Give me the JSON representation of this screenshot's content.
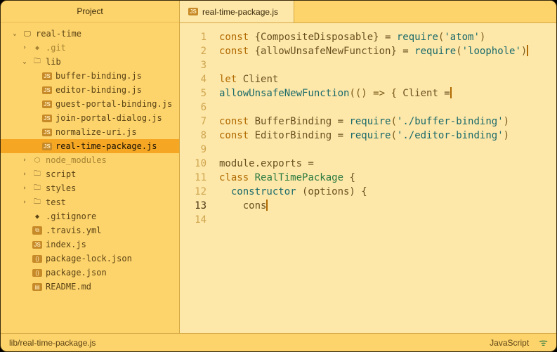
{
  "sidebar": {
    "header": "Project",
    "root": {
      "label": "real-time"
    },
    "items": [
      {
        "label": ".git",
        "icon": "git",
        "muted": true,
        "indent": 1,
        "expandable": true,
        "expanded": false
      },
      {
        "label": "lib",
        "icon": "folder",
        "indent": 1,
        "expandable": true,
        "expanded": true
      },
      {
        "label": "buffer-binding.js",
        "icon": "js",
        "indent": 2
      },
      {
        "label": "editor-binding.js",
        "icon": "js",
        "indent": 2
      },
      {
        "label": "guest-portal-binding.js",
        "icon": "js",
        "indent": 2
      },
      {
        "label": "join-portal-dialog.js",
        "icon": "js",
        "indent": 2
      },
      {
        "label": "normalize-uri.js",
        "icon": "js",
        "indent": 2
      },
      {
        "label": "real-time-package.js",
        "icon": "js",
        "indent": 2,
        "selected": true
      },
      {
        "label": "node_modules",
        "icon": "pkg",
        "muted": true,
        "indent": 1,
        "expandable": true,
        "expanded": false
      },
      {
        "label": "script",
        "icon": "folder",
        "indent": 1,
        "expandable": true,
        "expanded": false
      },
      {
        "label": "styles",
        "icon": "folder",
        "indent": 1,
        "expandable": true,
        "expanded": false
      },
      {
        "label": "test",
        "icon": "folder",
        "indent": 1,
        "expandable": true,
        "expanded": false
      },
      {
        "label": ".gitignore",
        "icon": "git",
        "indent": 1
      },
      {
        "label": ".travis.yml",
        "icon": "yml",
        "indent": 1
      },
      {
        "label": "index.js",
        "icon": "js",
        "indent": 1
      },
      {
        "label": "package-lock.json",
        "icon": "json",
        "indent": 1
      },
      {
        "label": "package.json",
        "icon": "json",
        "indent": 1
      },
      {
        "label": "README.md",
        "icon": "md",
        "indent": 1
      }
    ]
  },
  "tabs": {
    "active": {
      "label": "real-time-package.js"
    }
  },
  "editor": {
    "current_line": 13,
    "lines": [
      {
        "n": 1,
        "tokens": [
          [
            "kw",
            "const"
          ],
          [
            "plain",
            " {CompositeDisposable} = "
          ],
          [
            "fn",
            "require"
          ],
          [
            "punc",
            "("
          ],
          [
            "str",
            "'atom'"
          ],
          [
            "punc",
            ")"
          ]
        ]
      },
      {
        "n": 2,
        "tokens": [
          [
            "kw",
            "const"
          ],
          [
            "plain",
            " {allowUnsafeNewFunction} = "
          ],
          [
            "fn",
            "require"
          ],
          [
            "punc",
            "("
          ],
          [
            "str",
            "'loophole'"
          ],
          [
            "punc",
            ")"
          ]
        ],
        "cursor_end": true
      },
      {
        "n": 3,
        "tokens": []
      },
      {
        "n": 4,
        "tokens": [
          [
            "kw",
            "let"
          ],
          [
            "plain",
            " Client"
          ]
        ]
      },
      {
        "n": 5,
        "tokens": [
          [
            "fn",
            "allowUnsafeNewFunction"
          ],
          [
            "punc",
            "(() => { "
          ],
          [
            "plain",
            "Client ="
          ]
        ],
        "cursor_end": true
      },
      {
        "n": 6,
        "tokens": []
      },
      {
        "n": 7,
        "tokens": [
          [
            "kw",
            "const"
          ],
          [
            "plain",
            " BufferBinding = "
          ],
          [
            "fn",
            "require"
          ],
          [
            "punc",
            "("
          ],
          [
            "str",
            "'./buffer-binding'"
          ],
          [
            "punc",
            ")"
          ]
        ]
      },
      {
        "n": 8,
        "tokens": [
          [
            "kw",
            "const"
          ],
          [
            "plain",
            " EditorBinding = "
          ],
          [
            "fn",
            "require"
          ],
          [
            "punc",
            "("
          ],
          [
            "str",
            "'./editor-binding'"
          ],
          [
            "punc",
            ")"
          ]
        ]
      },
      {
        "n": 9,
        "tokens": []
      },
      {
        "n": 10,
        "tokens": [
          [
            "plain",
            "module.exports ="
          ]
        ]
      },
      {
        "n": 11,
        "tokens": [
          [
            "kw",
            "class"
          ],
          [
            "plain",
            " "
          ],
          [
            "type",
            "RealTimePackage"
          ],
          [
            "plain",
            " {"
          ]
        ]
      },
      {
        "n": 12,
        "tokens": [
          [
            "plain",
            "  "
          ],
          [
            "fn",
            "constructor"
          ],
          [
            "plain",
            " (options) {"
          ]
        ]
      },
      {
        "n": 13,
        "tokens": [
          [
            "plain",
            "    cons"
          ]
        ],
        "cursor_end": true
      },
      {
        "n": 14,
        "tokens": []
      }
    ]
  },
  "statusbar": {
    "path": "lib/real-time-package.js",
    "language": "JavaScript"
  },
  "icons": {
    "js": "JS",
    "json": "{}",
    "md": "▤",
    "yml": "⧉",
    "folder": "📁",
    "git": "◆",
    "pkg": "⬡"
  }
}
